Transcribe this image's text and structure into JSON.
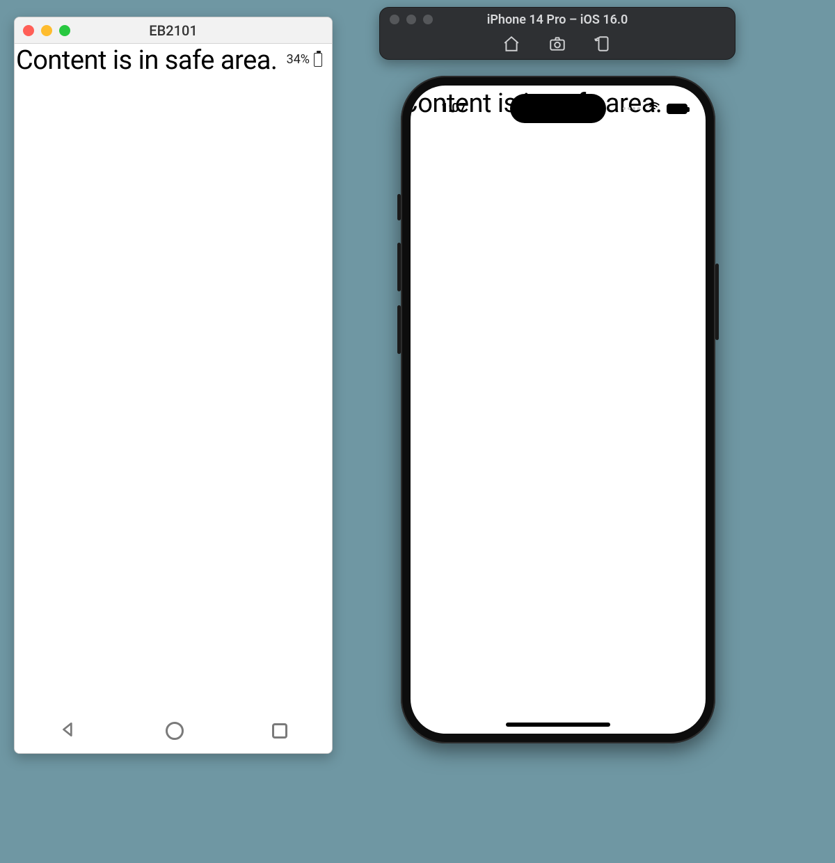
{
  "android": {
    "window_title": "EB2101",
    "content_text": "Content is in safe area.",
    "battery_pct": "34%",
    "nav": {
      "back": "back",
      "home": "home",
      "recent": "recent"
    }
  },
  "ios_toolbar": {
    "title": "iPhone 14 Pro – iOS 16.0",
    "icons": {
      "home": "home-icon",
      "screenshot": "screenshot-icon",
      "rotate": "rotate-icon"
    }
  },
  "iphone": {
    "content_text": "Content is in safe area.",
    "time": "1:07"
  }
}
